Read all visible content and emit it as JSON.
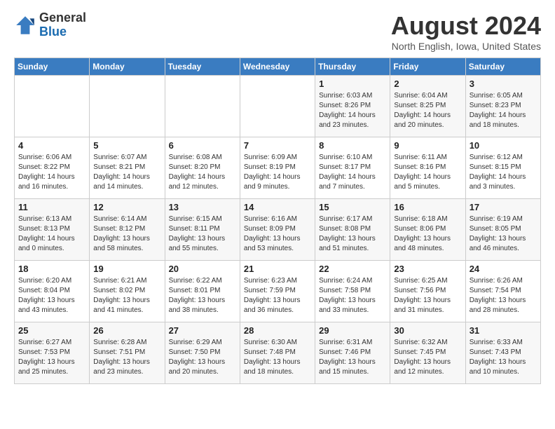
{
  "header": {
    "logo_line1": "General",
    "logo_line2": "Blue",
    "month": "August 2024",
    "location": "North English, Iowa, United States"
  },
  "weekdays": [
    "Sunday",
    "Monday",
    "Tuesday",
    "Wednesday",
    "Thursday",
    "Friday",
    "Saturday"
  ],
  "weeks": [
    [
      {
        "num": "",
        "info": ""
      },
      {
        "num": "",
        "info": ""
      },
      {
        "num": "",
        "info": ""
      },
      {
        "num": "",
        "info": ""
      },
      {
        "num": "1",
        "info": "Sunrise: 6:03 AM\nSunset: 8:26 PM\nDaylight: 14 hours\nand 23 minutes."
      },
      {
        "num": "2",
        "info": "Sunrise: 6:04 AM\nSunset: 8:25 PM\nDaylight: 14 hours\nand 20 minutes."
      },
      {
        "num": "3",
        "info": "Sunrise: 6:05 AM\nSunset: 8:23 PM\nDaylight: 14 hours\nand 18 minutes."
      }
    ],
    [
      {
        "num": "4",
        "info": "Sunrise: 6:06 AM\nSunset: 8:22 PM\nDaylight: 14 hours\nand 16 minutes."
      },
      {
        "num": "5",
        "info": "Sunrise: 6:07 AM\nSunset: 8:21 PM\nDaylight: 14 hours\nand 14 minutes."
      },
      {
        "num": "6",
        "info": "Sunrise: 6:08 AM\nSunset: 8:20 PM\nDaylight: 14 hours\nand 12 minutes."
      },
      {
        "num": "7",
        "info": "Sunrise: 6:09 AM\nSunset: 8:19 PM\nDaylight: 14 hours\nand 9 minutes."
      },
      {
        "num": "8",
        "info": "Sunrise: 6:10 AM\nSunset: 8:17 PM\nDaylight: 14 hours\nand 7 minutes."
      },
      {
        "num": "9",
        "info": "Sunrise: 6:11 AM\nSunset: 8:16 PM\nDaylight: 14 hours\nand 5 minutes."
      },
      {
        "num": "10",
        "info": "Sunrise: 6:12 AM\nSunset: 8:15 PM\nDaylight: 14 hours\nand 3 minutes."
      }
    ],
    [
      {
        "num": "11",
        "info": "Sunrise: 6:13 AM\nSunset: 8:13 PM\nDaylight: 14 hours\nand 0 minutes."
      },
      {
        "num": "12",
        "info": "Sunrise: 6:14 AM\nSunset: 8:12 PM\nDaylight: 13 hours\nand 58 minutes."
      },
      {
        "num": "13",
        "info": "Sunrise: 6:15 AM\nSunset: 8:11 PM\nDaylight: 13 hours\nand 55 minutes."
      },
      {
        "num": "14",
        "info": "Sunrise: 6:16 AM\nSunset: 8:09 PM\nDaylight: 13 hours\nand 53 minutes."
      },
      {
        "num": "15",
        "info": "Sunrise: 6:17 AM\nSunset: 8:08 PM\nDaylight: 13 hours\nand 51 minutes."
      },
      {
        "num": "16",
        "info": "Sunrise: 6:18 AM\nSunset: 8:06 PM\nDaylight: 13 hours\nand 48 minutes."
      },
      {
        "num": "17",
        "info": "Sunrise: 6:19 AM\nSunset: 8:05 PM\nDaylight: 13 hours\nand 46 minutes."
      }
    ],
    [
      {
        "num": "18",
        "info": "Sunrise: 6:20 AM\nSunset: 8:04 PM\nDaylight: 13 hours\nand 43 minutes."
      },
      {
        "num": "19",
        "info": "Sunrise: 6:21 AM\nSunset: 8:02 PM\nDaylight: 13 hours\nand 41 minutes."
      },
      {
        "num": "20",
        "info": "Sunrise: 6:22 AM\nSunset: 8:01 PM\nDaylight: 13 hours\nand 38 minutes."
      },
      {
        "num": "21",
        "info": "Sunrise: 6:23 AM\nSunset: 7:59 PM\nDaylight: 13 hours\nand 36 minutes."
      },
      {
        "num": "22",
        "info": "Sunrise: 6:24 AM\nSunset: 7:58 PM\nDaylight: 13 hours\nand 33 minutes."
      },
      {
        "num": "23",
        "info": "Sunrise: 6:25 AM\nSunset: 7:56 PM\nDaylight: 13 hours\nand 31 minutes."
      },
      {
        "num": "24",
        "info": "Sunrise: 6:26 AM\nSunset: 7:54 PM\nDaylight: 13 hours\nand 28 minutes."
      }
    ],
    [
      {
        "num": "25",
        "info": "Sunrise: 6:27 AM\nSunset: 7:53 PM\nDaylight: 13 hours\nand 25 minutes."
      },
      {
        "num": "26",
        "info": "Sunrise: 6:28 AM\nSunset: 7:51 PM\nDaylight: 13 hours\nand 23 minutes."
      },
      {
        "num": "27",
        "info": "Sunrise: 6:29 AM\nSunset: 7:50 PM\nDaylight: 13 hours\nand 20 minutes."
      },
      {
        "num": "28",
        "info": "Sunrise: 6:30 AM\nSunset: 7:48 PM\nDaylight: 13 hours\nand 18 minutes."
      },
      {
        "num": "29",
        "info": "Sunrise: 6:31 AM\nSunset: 7:46 PM\nDaylight: 13 hours\nand 15 minutes."
      },
      {
        "num": "30",
        "info": "Sunrise: 6:32 AM\nSunset: 7:45 PM\nDaylight: 13 hours\nand 12 minutes."
      },
      {
        "num": "31",
        "info": "Sunrise: 6:33 AM\nSunset: 7:43 PM\nDaylight: 13 hours\nand 10 minutes."
      }
    ]
  ]
}
